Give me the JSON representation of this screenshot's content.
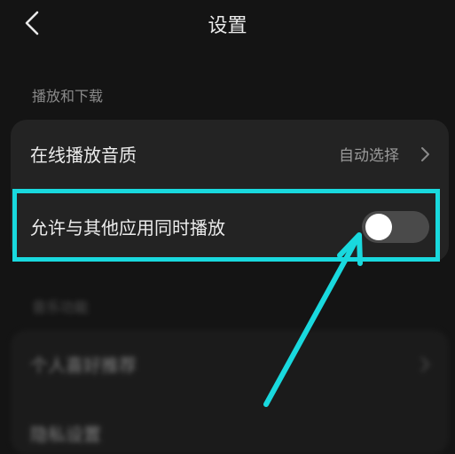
{
  "nav": {
    "title": "设置",
    "back_icon": "chevron-left-icon"
  },
  "playback": {
    "section_label": "播放和下载",
    "quality": {
      "label": "在线播放音质",
      "value": "自动选择"
    },
    "mix": {
      "label": "允许与其他应用同时播放",
      "enabled": false
    }
  },
  "personal": {
    "section_label": "音乐功能",
    "items": [
      {
        "label": "个人喜好推荐"
      },
      {
        "label": "隐私设置"
      }
    ]
  },
  "colors": {
    "highlight": "#19d9de",
    "background": "#141414",
    "card": "#232323"
  }
}
